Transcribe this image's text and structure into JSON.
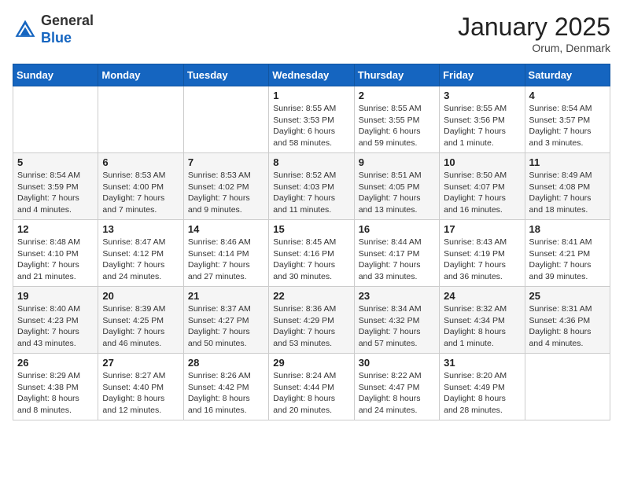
{
  "header": {
    "logo_line1": "General",
    "logo_line2": "Blue",
    "month": "January 2025",
    "location": "Orum, Denmark"
  },
  "weekdays": [
    "Sunday",
    "Monday",
    "Tuesday",
    "Wednesday",
    "Thursday",
    "Friday",
    "Saturday"
  ],
  "weeks": [
    [
      {
        "day": "",
        "info": ""
      },
      {
        "day": "",
        "info": ""
      },
      {
        "day": "",
        "info": ""
      },
      {
        "day": "1",
        "info": "Sunrise: 8:55 AM\nSunset: 3:53 PM\nDaylight: 6 hours\nand 58 minutes."
      },
      {
        "day": "2",
        "info": "Sunrise: 8:55 AM\nSunset: 3:55 PM\nDaylight: 6 hours\nand 59 minutes."
      },
      {
        "day": "3",
        "info": "Sunrise: 8:55 AM\nSunset: 3:56 PM\nDaylight: 7 hours\nand 1 minute."
      },
      {
        "day": "4",
        "info": "Sunrise: 8:54 AM\nSunset: 3:57 PM\nDaylight: 7 hours\nand 3 minutes."
      }
    ],
    [
      {
        "day": "5",
        "info": "Sunrise: 8:54 AM\nSunset: 3:59 PM\nDaylight: 7 hours\nand 4 minutes."
      },
      {
        "day": "6",
        "info": "Sunrise: 8:53 AM\nSunset: 4:00 PM\nDaylight: 7 hours\nand 7 minutes."
      },
      {
        "day": "7",
        "info": "Sunrise: 8:53 AM\nSunset: 4:02 PM\nDaylight: 7 hours\nand 9 minutes."
      },
      {
        "day": "8",
        "info": "Sunrise: 8:52 AM\nSunset: 4:03 PM\nDaylight: 7 hours\nand 11 minutes."
      },
      {
        "day": "9",
        "info": "Sunrise: 8:51 AM\nSunset: 4:05 PM\nDaylight: 7 hours\nand 13 minutes."
      },
      {
        "day": "10",
        "info": "Sunrise: 8:50 AM\nSunset: 4:07 PM\nDaylight: 7 hours\nand 16 minutes."
      },
      {
        "day": "11",
        "info": "Sunrise: 8:49 AM\nSunset: 4:08 PM\nDaylight: 7 hours\nand 18 minutes."
      }
    ],
    [
      {
        "day": "12",
        "info": "Sunrise: 8:48 AM\nSunset: 4:10 PM\nDaylight: 7 hours\nand 21 minutes."
      },
      {
        "day": "13",
        "info": "Sunrise: 8:47 AM\nSunset: 4:12 PM\nDaylight: 7 hours\nand 24 minutes."
      },
      {
        "day": "14",
        "info": "Sunrise: 8:46 AM\nSunset: 4:14 PM\nDaylight: 7 hours\nand 27 minutes."
      },
      {
        "day": "15",
        "info": "Sunrise: 8:45 AM\nSunset: 4:16 PM\nDaylight: 7 hours\nand 30 minutes."
      },
      {
        "day": "16",
        "info": "Sunrise: 8:44 AM\nSunset: 4:17 PM\nDaylight: 7 hours\nand 33 minutes."
      },
      {
        "day": "17",
        "info": "Sunrise: 8:43 AM\nSunset: 4:19 PM\nDaylight: 7 hours\nand 36 minutes."
      },
      {
        "day": "18",
        "info": "Sunrise: 8:41 AM\nSunset: 4:21 PM\nDaylight: 7 hours\nand 39 minutes."
      }
    ],
    [
      {
        "day": "19",
        "info": "Sunrise: 8:40 AM\nSunset: 4:23 PM\nDaylight: 7 hours\nand 43 minutes."
      },
      {
        "day": "20",
        "info": "Sunrise: 8:39 AM\nSunset: 4:25 PM\nDaylight: 7 hours\nand 46 minutes."
      },
      {
        "day": "21",
        "info": "Sunrise: 8:37 AM\nSunset: 4:27 PM\nDaylight: 7 hours\nand 50 minutes."
      },
      {
        "day": "22",
        "info": "Sunrise: 8:36 AM\nSunset: 4:29 PM\nDaylight: 7 hours\nand 53 minutes."
      },
      {
        "day": "23",
        "info": "Sunrise: 8:34 AM\nSunset: 4:32 PM\nDaylight: 7 hours\nand 57 minutes."
      },
      {
        "day": "24",
        "info": "Sunrise: 8:32 AM\nSunset: 4:34 PM\nDaylight: 8 hours\nand 1 minute."
      },
      {
        "day": "25",
        "info": "Sunrise: 8:31 AM\nSunset: 4:36 PM\nDaylight: 8 hours\nand 4 minutes."
      }
    ],
    [
      {
        "day": "26",
        "info": "Sunrise: 8:29 AM\nSunset: 4:38 PM\nDaylight: 8 hours\nand 8 minutes."
      },
      {
        "day": "27",
        "info": "Sunrise: 8:27 AM\nSunset: 4:40 PM\nDaylight: 8 hours\nand 12 minutes."
      },
      {
        "day": "28",
        "info": "Sunrise: 8:26 AM\nSunset: 4:42 PM\nDaylight: 8 hours\nand 16 minutes."
      },
      {
        "day": "29",
        "info": "Sunrise: 8:24 AM\nSunset: 4:44 PM\nDaylight: 8 hours\nand 20 minutes."
      },
      {
        "day": "30",
        "info": "Sunrise: 8:22 AM\nSunset: 4:47 PM\nDaylight: 8 hours\nand 24 minutes."
      },
      {
        "day": "31",
        "info": "Sunrise: 8:20 AM\nSunset: 4:49 PM\nDaylight: 8 hours\nand 28 minutes."
      },
      {
        "day": "",
        "info": ""
      }
    ]
  ]
}
